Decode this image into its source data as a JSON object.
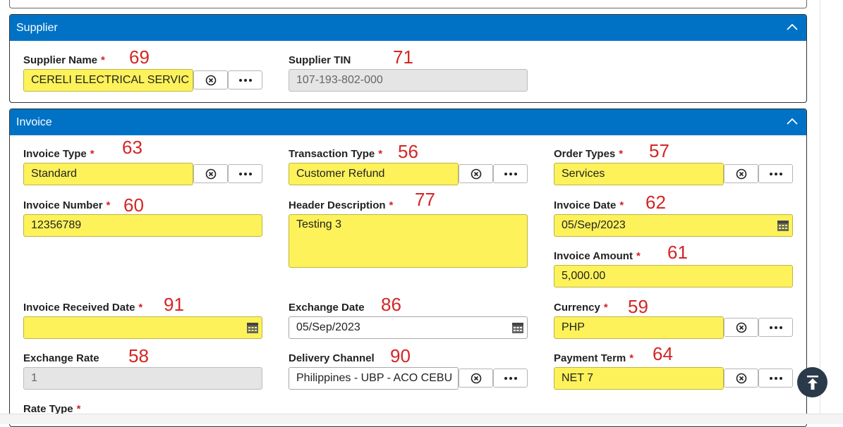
{
  "supplier": {
    "title": "Supplier",
    "name_label": "Supplier Name",
    "name_value": "CERELI ELECTRICAL SERVIC",
    "name_anno": "69",
    "tin_label": "Supplier TIN",
    "tin_value": "107-193-802-000",
    "tin_anno": "71"
  },
  "invoice": {
    "title": "Invoice",
    "required_mark": "*",
    "invoice_type": {
      "label": "Invoice Type",
      "value": "Standard",
      "anno": "63"
    },
    "transaction_type": {
      "label": "Transaction Type",
      "value": "Customer Refund",
      "anno": "56"
    },
    "order_types": {
      "label": "Order Types",
      "value": "Services",
      "anno": "57"
    },
    "invoice_number": {
      "label": "Invoice Number",
      "value": "12356789",
      "anno": "60"
    },
    "header_description": {
      "label": "Header Description",
      "value": "Testing 3",
      "anno": "77"
    },
    "invoice_date": {
      "label": "Invoice Date",
      "value": "05/Sep/2023",
      "anno": "62"
    },
    "invoice_amount": {
      "label": "Invoice Amount",
      "value": "5,000.00",
      "anno": "61"
    },
    "invoice_received_date": {
      "label": "Invoice Received Date",
      "value": "",
      "anno": "91"
    },
    "exchange_date": {
      "label": "Exchange Date",
      "value": "05/Sep/2023",
      "anno": "86"
    },
    "currency": {
      "label": "Currency",
      "value": "PHP",
      "anno": "59"
    },
    "exchange_rate": {
      "label": "Exchange Rate",
      "value": "1",
      "anno": "58"
    },
    "delivery_channel": {
      "label": "Delivery Channel",
      "value": "Philippines - UBP - ACO CEBU",
      "anno": "90"
    },
    "payment_term": {
      "label": "Payment Term",
      "value": "NET 7",
      "anno": "64"
    },
    "rate_type": {
      "label": "Rate Type"
    }
  },
  "colors": {
    "header_blue": "#0072c6",
    "required_field": "#fdf25a",
    "annotation_red": "#d42525"
  },
  "icons": [
    "chevron-up-icon",
    "clear-circle-x-icon",
    "ellipsis-icon",
    "calendar-icon",
    "scroll-to-top-icon"
  ]
}
